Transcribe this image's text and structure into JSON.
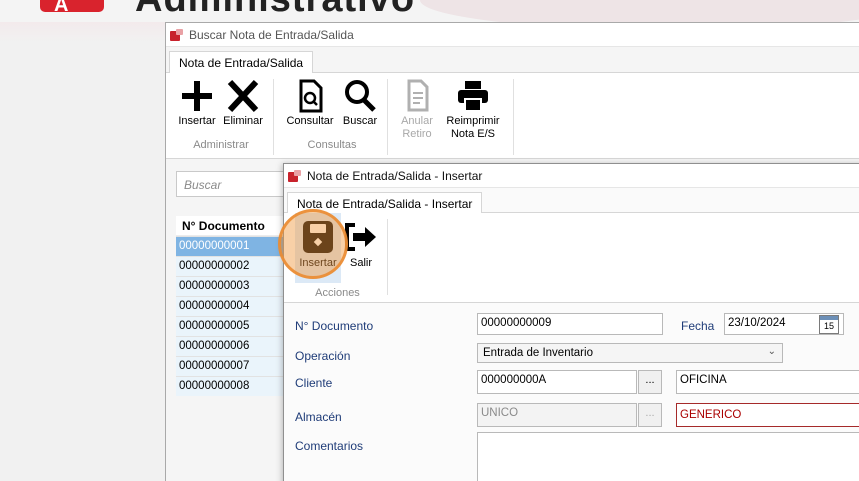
{
  "banner": {
    "logo_letter": "A",
    "app_title": "Administrativo"
  },
  "outer_window": {
    "title": "Buscar Nota de Entrada/Salida",
    "tab_label": "Nota de Entrada/Salida",
    "buttons": {
      "insertar": "Insertar",
      "eliminar": "Eliminar",
      "consultar": "Consultar",
      "buscar": "Buscar",
      "anular_line1": "Anular",
      "anular_line2": "Retiro",
      "reimprimir_line1": "Reimprimir",
      "reimprimir_line2": "Nota E/S"
    },
    "groups": {
      "administrar": "Administrar",
      "consultas": "Consultas"
    },
    "search_placeholder": "Buscar",
    "grid": {
      "header": "N° Documento",
      "rows": [
        "00000000001",
        "00000000002",
        "00000000003",
        "00000000004",
        "00000000005",
        "00000000006",
        "00000000007",
        "00000000008"
      ],
      "selected_index": 0
    }
  },
  "inner_window": {
    "title": "Nota de Entrada/Salida - Insertar",
    "tab_label": "Nota de Entrada/Salida - Insertar",
    "buttons": {
      "insertar": "Insertar",
      "salir": "Salir"
    },
    "groups": {
      "acciones": "Acciones"
    },
    "form": {
      "documento_label": "N° Documento",
      "documento_value": "00000000009",
      "fecha_label": "Fecha",
      "fecha_value": "23/10/2024",
      "calendar_day": "15",
      "operacion_label": "Operación",
      "operacion_value": "Entrada de Inventario",
      "cliente_label": "Cliente",
      "cliente_code": "000000000A",
      "cliente_name": "OFICINA",
      "almacen_label": "Almacén",
      "almacen_code": "UNICO",
      "almacen_name": "GENERICO",
      "comentarios_label": "Comentarios",
      "comentarios_value": "",
      "lookup_button": "..."
    }
  },
  "colors": {
    "accent_red": "#d9232d",
    "selection_blue": "#7fb4e3",
    "highlight_orange": "#f0963c",
    "label_blue": "#1f3c78"
  }
}
